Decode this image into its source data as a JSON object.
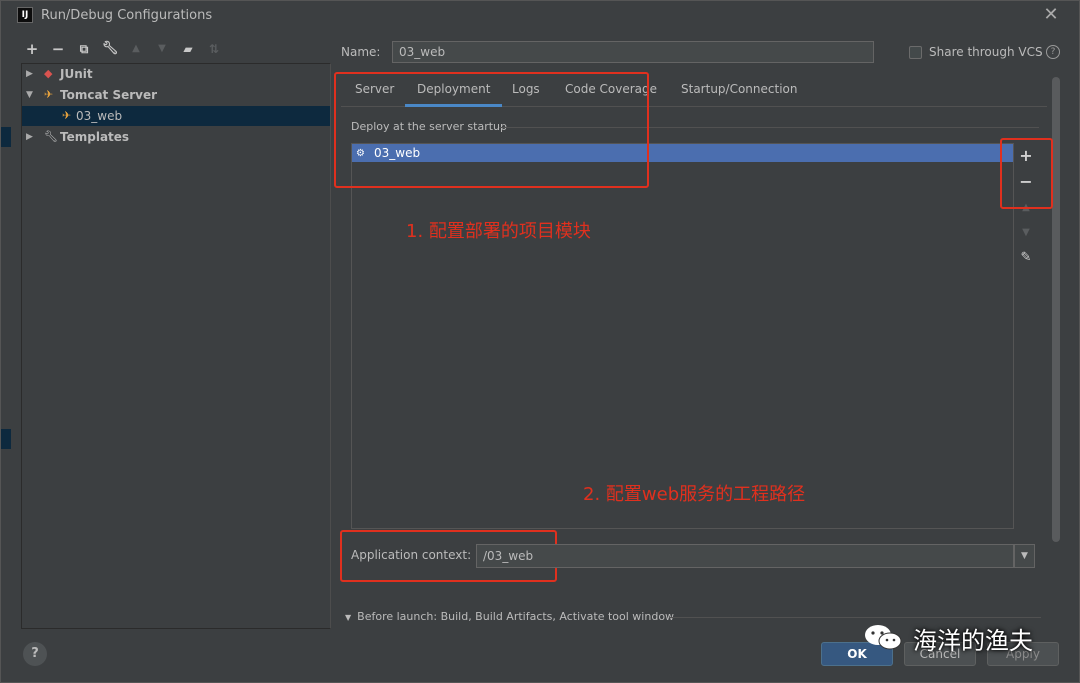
{
  "window": {
    "title": "Run/Debug Configurations",
    "app_icon": "IJ"
  },
  "tree": {
    "items": [
      {
        "label": "JUnit"
      },
      {
        "label": "Tomcat Server"
      },
      {
        "label": "03_web"
      },
      {
        "label": "Templates"
      }
    ]
  },
  "form": {
    "name_label": "Name:",
    "name_value": "03_web",
    "share_label": "Share through VCS"
  },
  "tabs": [
    {
      "label": "Server"
    },
    {
      "label": "Deployment"
    },
    {
      "label": "Logs"
    },
    {
      "label": "Code Coverage"
    },
    {
      "label": "Startup/Connection"
    }
  ],
  "deployment": {
    "section_label": "Deploy at the server startup",
    "items": [
      "03_web"
    ]
  },
  "context": {
    "label": "Application context:",
    "value": "/03_web"
  },
  "before_launch": "Before launch: Build, Build Artifacts, Activate tool window",
  "buttons": {
    "ok": "OK",
    "cancel": "Cancel",
    "apply": "Apply",
    "help": "?"
  },
  "annotations": {
    "step1": "1. 配置部署的项目模块",
    "step2": "2. 配置web服务的工程路径",
    "color": "#e0301e"
  },
  "watermark": {
    "text": "海洋的渔夫"
  },
  "colors": {
    "selection": "#4b6eaf",
    "tab_active": "#4a88c7",
    "ok_button": "#365880"
  }
}
